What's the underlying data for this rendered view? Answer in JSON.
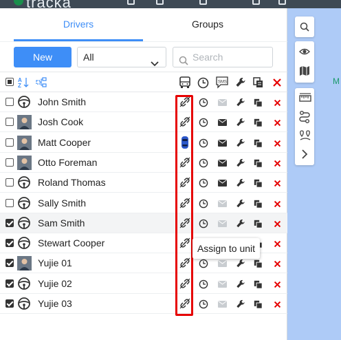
{
  "app": {
    "logo_text": "tracka"
  },
  "tabs": [
    {
      "label": "Drivers",
      "active": true
    },
    {
      "label": "Groups",
      "active": false
    }
  ],
  "toolbar": {
    "new_label": "New",
    "filter_value": "All",
    "search_placeholder": "Search"
  },
  "rows": [
    {
      "name": "John Smith",
      "avatar": "steering-wheel-icon",
      "checked": false,
      "unit_icon": "link-off-icon",
      "mail_active": false
    },
    {
      "name": "Josh Cook",
      "avatar": "photo",
      "checked": false,
      "unit_icon": "link-off-icon",
      "mail_active": true
    },
    {
      "name": "Matt Cooper",
      "avatar": "photo",
      "checked": false,
      "unit_icon": "car-icon",
      "mail_active": true
    },
    {
      "name": "Otto Foreman",
      "avatar": "photo",
      "checked": false,
      "unit_icon": "link-off-icon",
      "mail_active": true
    },
    {
      "name": "Roland Thomas",
      "avatar": "steering-wheel-icon",
      "checked": false,
      "unit_icon": "link-off-icon",
      "mail_active": true
    },
    {
      "name": "Sally Smith",
      "avatar": "steering-wheel-icon",
      "checked": false,
      "unit_icon": "link-off-icon",
      "mail_active": false
    },
    {
      "name": "Sam Smith",
      "avatar": "steering-wheel-icon",
      "checked": true,
      "unit_icon": "link-off-icon",
      "mail_active": false
    },
    {
      "name": "Stewart Cooper",
      "avatar": "steering-wheel-icon",
      "checked": true,
      "unit_icon": "link-off-icon",
      "mail_active": false
    },
    {
      "name": "Yujie 01",
      "avatar": "photo",
      "checked": true,
      "unit_icon": "link-off-icon",
      "mail_active": false
    },
    {
      "name": "Yujie 02",
      "avatar": "steering-wheel-icon",
      "checked": true,
      "unit_icon": "link-off-icon",
      "mail_active": false
    },
    {
      "name": "Yujie 03",
      "avatar": "steering-wheel-icon",
      "checked": true,
      "unit_icon": "link-off-icon",
      "mail_active": false
    }
  ],
  "tooltip": {
    "text": "Assign to unit"
  },
  "header_icons": [
    "select-all-checkbox",
    "sort-az-icon",
    "group-icon",
    "unit-bus-icon",
    "clock-icon",
    "sms-icon",
    "wrench-icon",
    "copy-icon",
    "delete-x-icon"
  ],
  "map": {
    "label": "M"
  },
  "colors": {
    "accent": "#3e8ef7",
    "delete": "#e60000",
    "highlight": "#e60000",
    "map": "#aecbf7"
  }
}
